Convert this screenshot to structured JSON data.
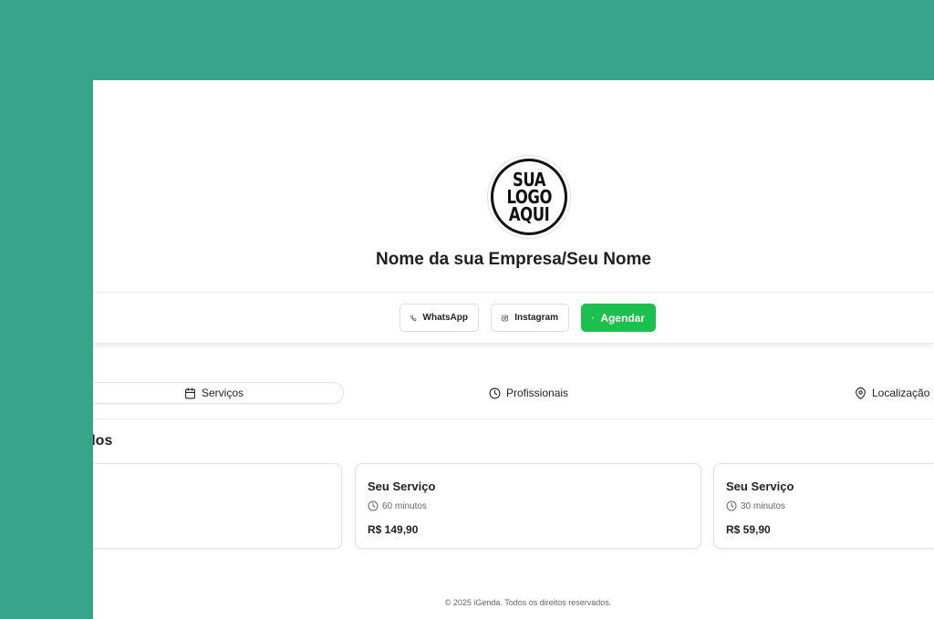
{
  "brand": {
    "logo_lines": [
      "SUA",
      "LOGO",
      "AQUI"
    ],
    "business_name": "Nome da sua Empresa/Seu Nome"
  },
  "actions": {
    "whatsapp_label": "WhatsApp",
    "instagram_label": "Instagram",
    "schedule_label": "Agendar"
  },
  "tabs": [
    {
      "label": "Serviços",
      "icon": "calendar-icon",
      "active": true
    },
    {
      "label": "Profissionais",
      "icon": "clock-icon",
      "active": false
    },
    {
      "label": "Localização",
      "icon": "map-pin-icon",
      "active": false
    }
  ],
  "section": {
    "title": "ados"
  },
  "services": [
    {
      "title": "",
      "duration": "",
      "price": ""
    },
    {
      "title": "Seu Serviço",
      "duration": "60 minutos",
      "price": "R$ 149,90"
    },
    {
      "title": "Seu Serviço",
      "duration": "30 minutos",
      "price": "R$ 59,90"
    }
  ],
  "footer": {
    "text": "© 2025 iGenda. Todos os direitos reservados."
  },
  "colors": {
    "background": "#38a58b",
    "accent_green": "#1cc04f",
    "panel": "#ffffff"
  }
}
